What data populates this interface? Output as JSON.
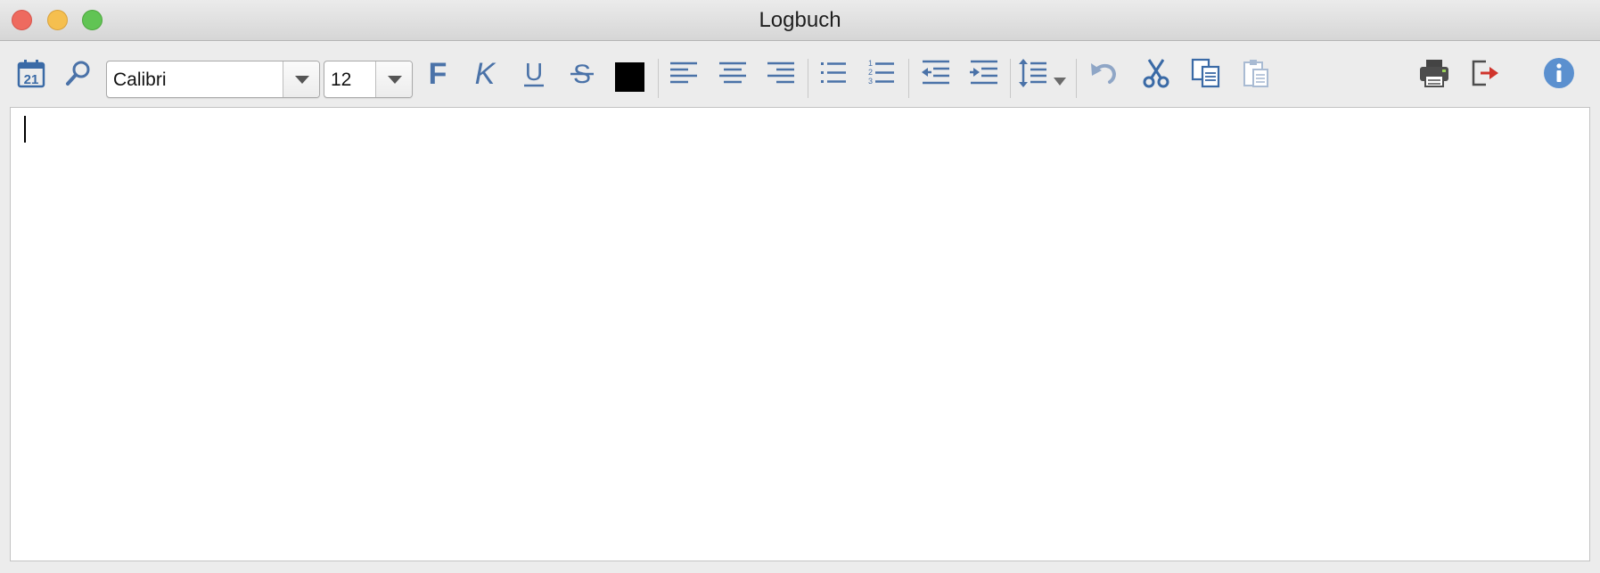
{
  "window": {
    "title": "Logbuch"
  },
  "toolbar": {
    "font_name": "Calibri",
    "font_size": "12",
    "text_color": "#000000",
    "icon_color": "#4a72a8"
  },
  "editor": {
    "content": ""
  }
}
